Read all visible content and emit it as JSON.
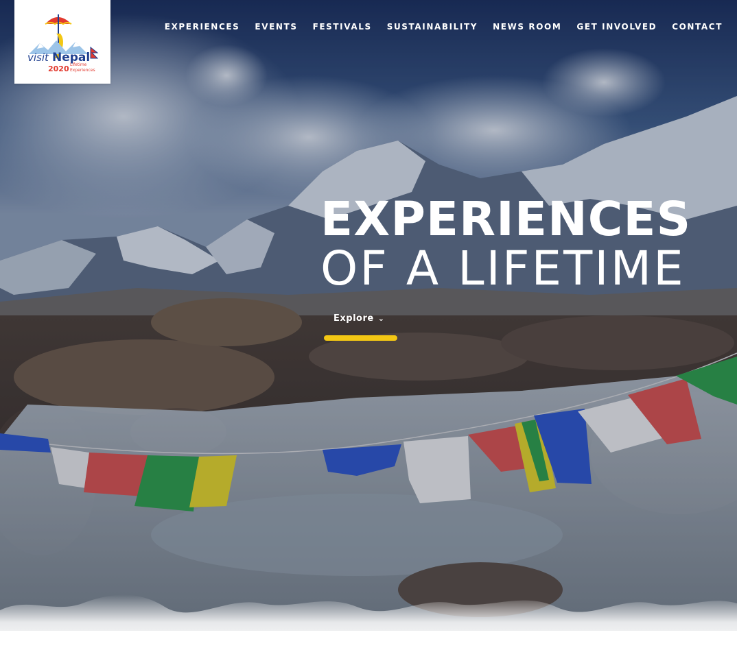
{
  "logo": {
    "brand_visit": "visit",
    "brand_nepal": "Nepal",
    "brand_year": "2020",
    "brand_tagline_1": "Lifetime",
    "brand_tagline_2": "Experiences"
  },
  "nav": {
    "items": [
      {
        "label": "EXPERIENCES"
      },
      {
        "label": "EVENTS"
      },
      {
        "label": "FESTIVALS"
      },
      {
        "label": "SUSTAINABILITY"
      },
      {
        "label": "NEWS ROOM"
      },
      {
        "label": "GET INVOLVED"
      },
      {
        "label": "CONTACT"
      }
    ]
  },
  "hero": {
    "title_line1": "EXPERIENCES",
    "title_line2": "OF A LIFETIME",
    "cta_label": "Explore",
    "cta_icon": "chevron-down-icon",
    "accent_color": "#f3c714"
  }
}
